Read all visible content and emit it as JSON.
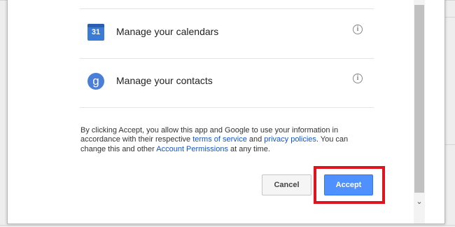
{
  "permissions": [
    {
      "icon": "calendar-icon",
      "icon_text": "31",
      "label": "Manage your calendars"
    },
    {
      "icon": "google-plus-icon",
      "icon_text": "g",
      "label": "Manage your contacts"
    }
  ],
  "legal": {
    "text_1": "By clicking Accept, you allow this app and Google to use your information in accordance with their respective ",
    "terms_link": "terms of service",
    "text_2": " and ",
    "privacy_link": "privacy policies",
    "text_3": ". You can change this and other ",
    "account_link": "Account Permissions",
    "text_4": " at any time."
  },
  "buttons": {
    "cancel": "Cancel",
    "accept": "Accept"
  },
  "colors": {
    "accent": "#4d90fe",
    "link": "#1155cc",
    "highlight": "#e0141e"
  }
}
